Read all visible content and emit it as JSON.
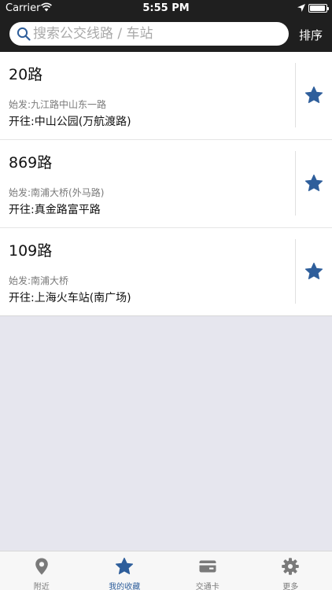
{
  "status_bar": {
    "carrier": "Carrier",
    "time": "5:55 PM"
  },
  "search": {
    "placeholder": "搜索公交线路 / 车站",
    "value": ""
  },
  "header": {
    "sort_label": "排序"
  },
  "routes": [
    {
      "name": "20路",
      "from": "始发:九江路中山东一路",
      "to": "开往:中山公园(万航渡路)"
    },
    {
      "name": "869路",
      "from": "始发:南浦大桥(外马路)",
      "to": "开往:真金路富平路"
    },
    {
      "name": "109路",
      "from": "始发:南浦大桥",
      "to": "开往:上海火车站(南广场)"
    }
  ],
  "tabs": [
    {
      "label": "附近",
      "icon": "location-pin-icon"
    },
    {
      "label": "我的收藏",
      "icon": "star-icon"
    },
    {
      "label": "交通卡",
      "icon": "card-icon"
    },
    {
      "label": "更多",
      "icon": "gear-icon"
    }
  ],
  "active_tab_index": 1,
  "colors": {
    "accent": "#2e5e9b",
    "header_bg": "#1f1f1f",
    "background": "#e6e6ee",
    "inactive_icon": "#7a7a7a"
  }
}
